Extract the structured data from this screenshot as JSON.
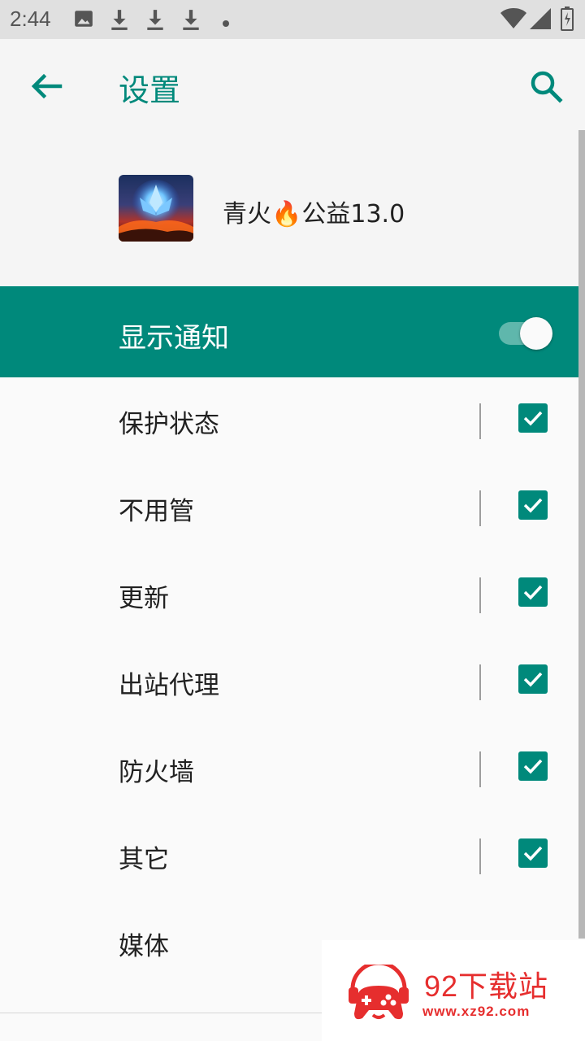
{
  "status_bar": {
    "time": "2:44",
    "icons": [
      "image-icon",
      "download-icon",
      "download-icon",
      "download-icon",
      "dot-icon",
      "wifi-icon",
      "signal-icon",
      "battery-icon"
    ]
  },
  "app_bar": {
    "title": "设置",
    "back_icon": "arrow-left-icon",
    "search_icon": "search-icon"
  },
  "app": {
    "name": "青火🔥公益13.0"
  },
  "notifications": {
    "label": "显示通知",
    "enabled": true
  },
  "channels": [
    {
      "label": "保护状态",
      "checked": true
    },
    {
      "label": "不用管",
      "checked": true
    },
    {
      "label": "更新",
      "checked": true
    },
    {
      "label": "出站代理",
      "checked": true
    },
    {
      "label": "防火墙",
      "checked": true
    },
    {
      "label": "其它",
      "checked": true
    },
    {
      "label": "媒体",
      "checked": false
    }
  ],
  "colors": {
    "accent": "#00897b",
    "watermark": "#e62e2e"
  },
  "watermark": {
    "title": "92下载站",
    "url": "www.xz92.com"
  }
}
